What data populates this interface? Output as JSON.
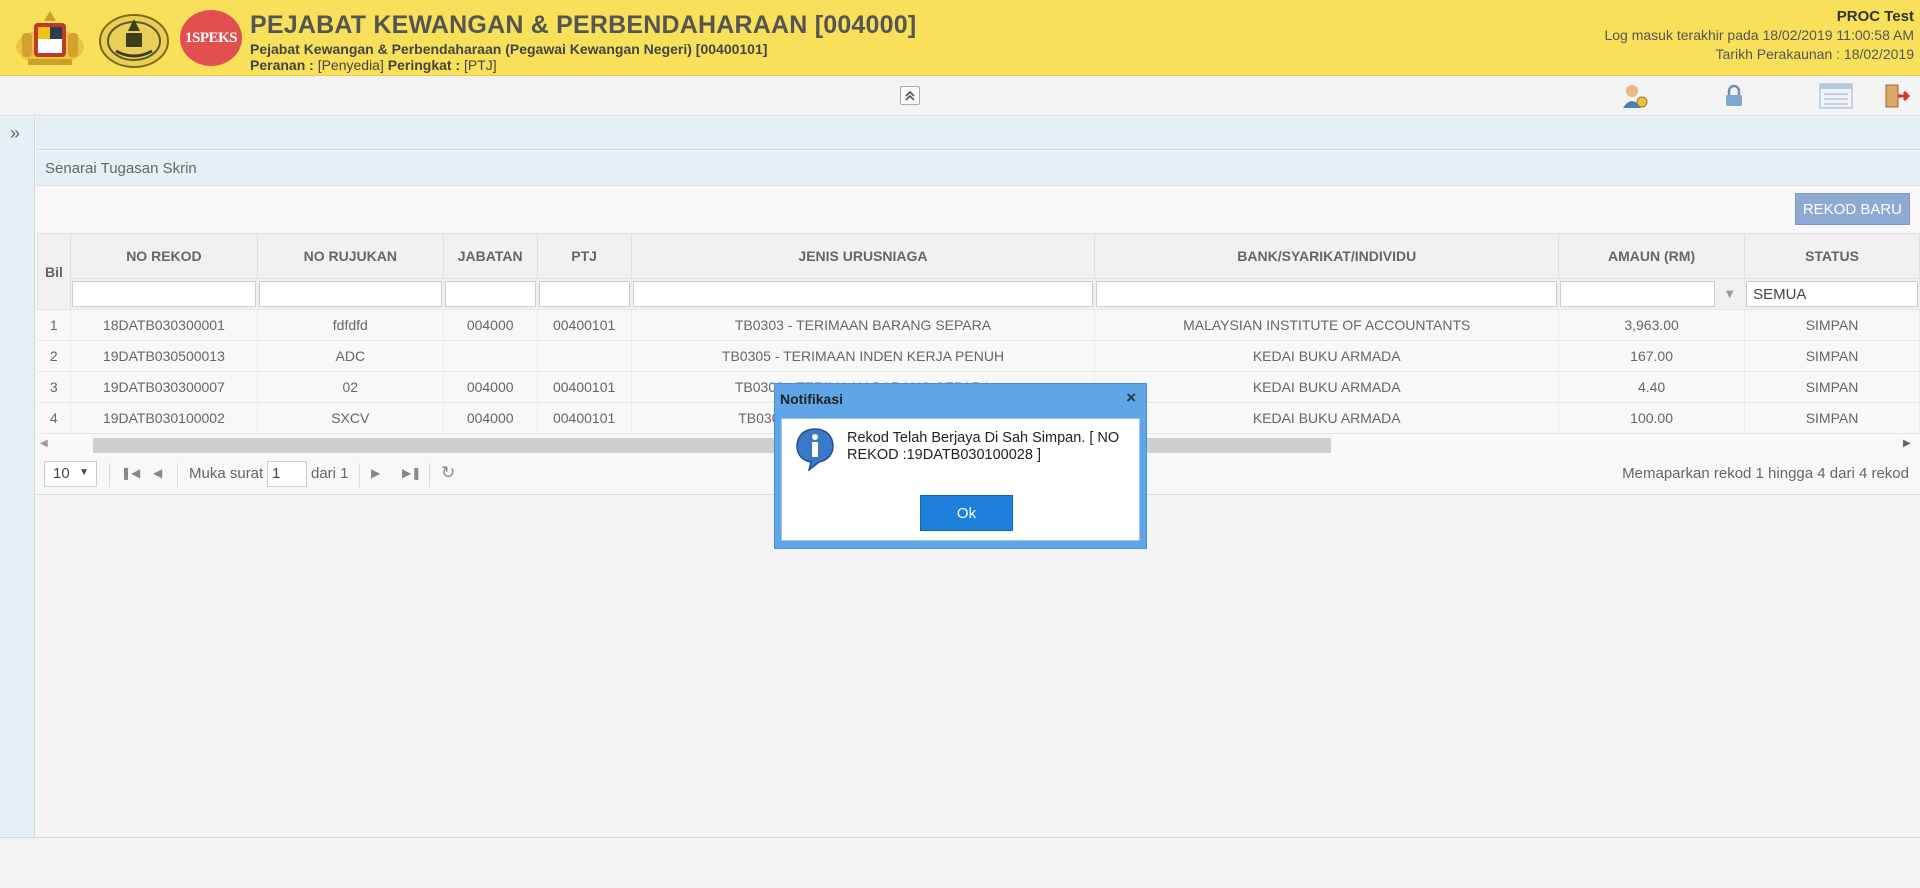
{
  "header": {
    "title": "PEJABAT KEWANGAN & PERBENDAHARAAN [004000]",
    "subtitle": "Pejabat Kewangan & Perbendaharaan (Pegawai Kewangan Negeri) [00400101]",
    "role_label": "Peranan :",
    "role_value": "[Penyedia]",
    "level_label": "Peringkat :",
    "level_value": "[PTJ]",
    "user": "PROC Test",
    "last_login": "Log masuk terakhir pada 18/02/2019 11:00:58 AM",
    "account_date": "Tarikh Perakaunan : 18/02/2019",
    "logo_1speks": "1SPEKS"
  },
  "toolbar": {
    "icons": [
      "user-profile-icon",
      "lock-icon",
      "list-view-icon",
      "logout-icon"
    ]
  },
  "panel": {
    "title": "Senarai Tugasan Skrin",
    "new_button": "REKOD BARU"
  },
  "grid": {
    "columns": [
      "Bil",
      "NO REKOD",
      "NO RUJUKAN",
      "JABATAN",
      "PTJ",
      "JENIS URUSNIAGA",
      "BANK/SYARIKAT/INDIVIDU",
      "AMAUN (RM)",
      "STATUS"
    ],
    "status_filter": "SEMUA",
    "rows": [
      {
        "bil": "1",
        "no_rekod": "18DATB030300001",
        "no_rujukan": "fdfdfd",
        "jabatan": "004000",
        "ptj": "00400101",
        "jenis": "TB0303 - TERIMAAN BARANG SEPARA",
        "bank": "MALAYSIAN INSTITUTE OF ACCOUNTANTS",
        "amaun": "3,963.00",
        "status": "SIMPAN"
      },
      {
        "bil": "2",
        "no_rekod": "19DATB030500013",
        "no_rujukan": "ADC",
        "jabatan": "",
        "ptj": "",
        "jenis": "TB0305 - TERIMAAN INDEN KERJA PENUH",
        "bank": "KEDAI BUKU ARMADA",
        "amaun": "167.00",
        "status": "SIMPAN"
      },
      {
        "bil": "3",
        "no_rekod": "19DATB030300007",
        "no_rujukan": "02",
        "jabatan": "004000",
        "ptj": "00400101",
        "jenis": "TB0303 - TERIMAAN BARANG SEPARA",
        "bank": "KEDAI BUKU ARMADA",
        "amaun": "4.40",
        "status": "SIMPAN"
      },
      {
        "bil": "4",
        "no_rekod": "19DATB030100002",
        "no_rujukan": "SXCV",
        "jabatan": "004000",
        "ptj": "00400101",
        "jenis": "TB0301 - TERIMAAN BARANG PENUH",
        "bank": "KEDAI BUKU ARMADA",
        "amaun": "100.00",
        "status": "SIMPAN"
      }
    ]
  },
  "pager": {
    "page_size": "10",
    "page_label": "Muka surat",
    "page_value": "1",
    "of_label": "dari 1",
    "info": "Memaparkan rekod 1 hingga 4 dari 4 rekod"
  },
  "dialog": {
    "title": "Notifikasi",
    "message": "Rekod Telah Berjaya Di Sah Simpan. [ NO REKOD :19DATB030100028 ]",
    "ok": "Ok"
  },
  "colors": {
    "header_bg": "#f9e05a",
    "dialog_frame": "#5fa6e8",
    "ok_button": "#1f7fdc",
    "new_button": "#8fa9d2"
  }
}
